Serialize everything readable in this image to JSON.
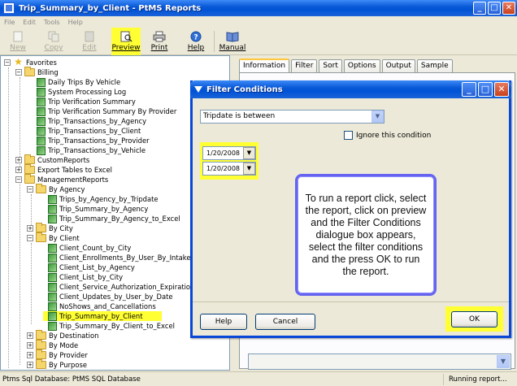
{
  "window": {
    "title": "Trip_Summary_by_Client - PtMS Reports",
    "controls": {
      "minimize": "_",
      "maximize": "□",
      "close": "✕"
    }
  },
  "menu": [
    "File",
    "Edit",
    "Tools",
    "Help"
  ],
  "toolbar": {
    "new": "New",
    "copy": "Copy",
    "edit": "Edit",
    "preview": "Preview",
    "print": "Print",
    "help": "Help",
    "manual": "Manual"
  },
  "tree": {
    "favorites": "Favorites",
    "billing": "Billing",
    "billing_items": [
      "Daily Trips By Vehicle",
      "System Processing Log",
      "Trip Verification Summary",
      "Trip Verification Summary By Provider",
      "Trip_Transactions_by_Agency",
      "Trip_Transactions_by_Client",
      "Trip_Transactions_by_Provider",
      "Trip_Transactions_by_Vehicle"
    ],
    "custom_reports": "CustomReports",
    "export_tables": "Export Tables to Excel",
    "management_reports": "ManagementReports",
    "by_agency": "By Agency",
    "by_agency_items": [
      "Trips_by_Agency_by_Tripdate",
      "Trip_Summary_by_Agency",
      "Trip_Summary_By_Agency_to_Excel"
    ],
    "by_city": "By City",
    "by_client": "By Client",
    "by_client_items": [
      "Client_Count_by_City",
      "Client_Enrollments_By_User_By_Intake",
      "Client_List_by_Agency",
      "Client_List_by_City",
      "Client_Service_Authorization_Expiration",
      "Client_Updates_by_User_by_Date",
      "NoShows_and_Cancellations",
      "Trip_Summary_by_Client",
      "Trip_Summary_By_Client_to_Excel"
    ],
    "by_destination": "By Destination",
    "by_mode": "By Mode",
    "by_provider": "By Provider",
    "by_purpose": "By Purpose"
  },
  "tabs": [
    "Information",
    "Filter",
    "Sort",
    "Options",
    "Output",
    "Sample"
  ],
  "dialog": {
    "title": "Filter Conditions",
    "condition": "Tripdate is between",
    "ignore_label": "Ignore this condition",
    "date_from": "1/20/2008",
    "date_to": "1/20/2008",
    "callout": "To run a report click, select the report, click on preview and the Filter Conditions dialogue box appears, select the filter conditions and the press OK to run the report.",
    "help_button": "Help",
    "cancel_button": "Cancel",
    "ok_button": "OK"
  },
  "status": {
    "database": "Ptms Sql Database: PtMS SQL Database",
    "state": "Running report..."
  },
  "colors": {
    "highlight": "#ffff33",
    "xp_blue": "#0a5ad8",
    "callout_border": "#6464f0"
  }
}
